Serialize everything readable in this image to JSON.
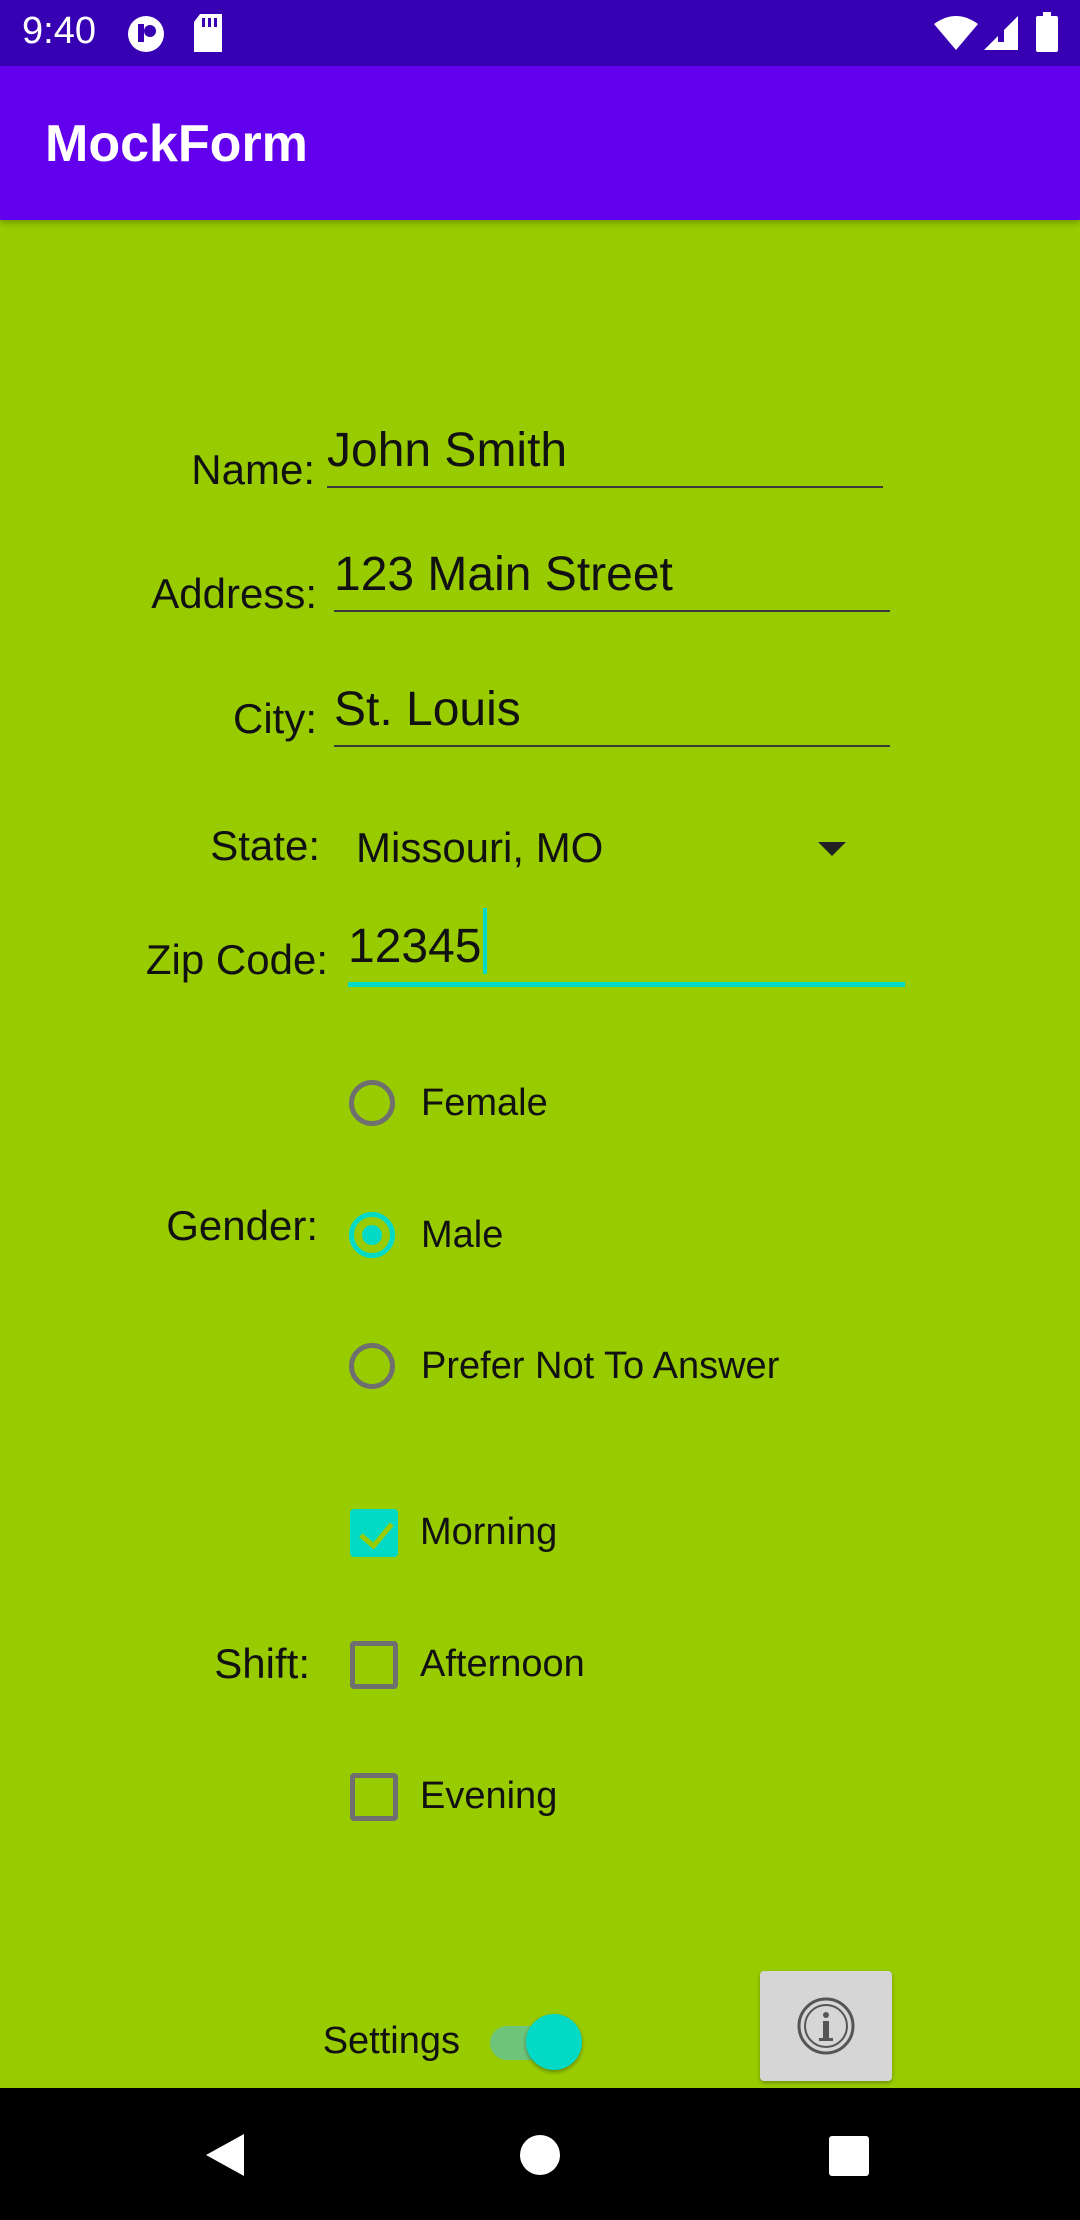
{
  "status_bar": {
    "time": "9:40",
    "icons": [
      "notification-icon",
      "sd-card-icon",
      "wifi-icon",
      "signal-icon",
      "battery-icon"
    ]
  },
  "app_bar": {
    "title": "MockForm"
  },
  "form": {
    "name": {
      "label": "Name:",
      "value": "John Smith"
    },
    "address": {
      "label": "Address:",
      "value": "123 Main Street"
    },
    "city": {
      "label": "City:",
      "value": "St. Louis"
    },
    "state": {
      "label": "State:",
      "selected": "Missouri, MO"
    },
    "zip": {
      "label": "Zip Code:",
      "value": "12345"
    },
    "gender": {
      "label": "Gender:",
      "options": [
        {
          "label": "Female",
          "checked": false
        },
        {
          "label": "Male",
          "checked": true
        },
        {
          "label": "Prefer Not To Answer",
          "checked": false
        }
      ]
    },
    "shift": {
      "label": "Shift:",
      "options": [
        {
          "label": "Morning",
          "checked": true
        },
        {
          "label": "Afternoon",
          "checked": false
        },
        {
          "label": "Evening",
          "checked": false
        }
      ]
    },
    "settings": {
      "label": "Settings",
      "on": true
    },
    "info_button": {
      "icon": "info-icon"
    }
  },
  "nav_bar": {
    "buttons": [
      "back-icon",
      "home-icon",
      "recents-icon"
    ]
  },
  "colors": {
    "status_bar": "#3700b3",
    "app_bar": "#6200ee",
    "background": "#99cc00",
    "accent": "#03dac5",
    "nav_bar": "#000000"
  }
}
